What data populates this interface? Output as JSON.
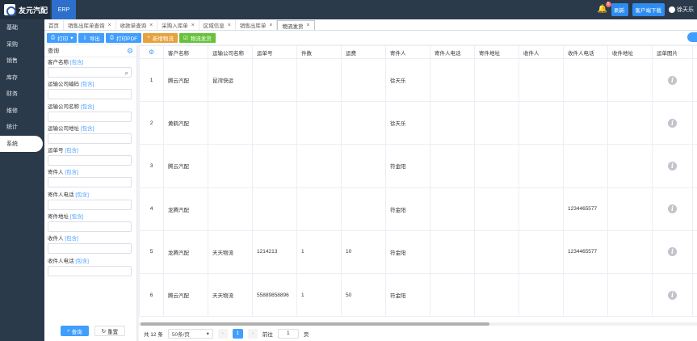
{
  "app": {
    "logo_text": "友元汽配",
    "module": "ERP"
  },
  "topbar": {
    "notification_count": "5",
    "refresh": "刷新",
    "client_download": "客户端下载",
    "user_name": "徐天乐"
  },
  "leftnav": [
    "基础",
    "采购",
    "销售",
    "库存",
    "财务",
    "维修",
    "统计",
    "系统"
  ],
  "tabs": [
    {
      "label": "首页",
      "closable": false
    },
    {
      "label": "销售出库单查询",
      "closable": true
    },
    {
      "label": "收款单查询",
      "closable": true
    },
    {
      "label": "采购入库单",
      "closable": true
    },
    {
      "label": "区域信息",
      "closable": true
    },
    {
      "label": "销售出库单",
      "closable": true
    },
    {
      "label": "物流发货",
      "closable": true,
      "active": true
    }
  ],
  "toolbar": {
    "print": "打印",
    "export": "导出",
    "print_pdf": "打印PDF",
    "add_logistics": "新增物流",
    "ship": "物流发货"
  },
  "search": {
    "title": "查询",
    "include": "[包含]",
    "fields": [
      "客户名称",
      "运输公司编码",
      "运输公司名称",
      "运输公司地址",
      "运单号",
      "寄件人",
      "寄件人电话",
      "寄件地址",
      "收件人",
      "收件人电话"
    ],
    "query_btn": "查询",
    "reset_btn": "重置"
  },
  "table": {
    "columns": [
      "客户名称",
      "运输公司名称",
      "运单号",
      "件数",
      "运费",
      "寄件人",
      "寄件人电话",
      "寄件地址",
      "收件人",
      "收件人电话",
      "收件地址",
      "运单图片"
    ],
    "rows": [
      {
        "no": "1",
        "customer": "腾云汽配",
        "carrier": "昆湾快运",
        "waybill": "",
        "pieces": "",
        "fee": "",
        "sender": "徐天乐",
        "sender_phone": "",
        "sender_addr": "",
        "receiver": "",
        "receiver_phone": "",
        "receiver_addr": ""
      },
      {
        "no": "2",
        "customer": "黄鹤汽配",
        "carrier": "",
        "waybill": "",
        "pieces": "",
        "fee": "",
        "sender": "徐天乐",
        "sender_phone": "",
        "sender_addr": "",
        "receiver": "",
        "receiver_phone": "",
        "receiver_addr": ""
      },
      {
        "no": "3",
        "customer": "腾云汽配",
        "carrier": "",
        "waybill": "",
        "pieces": "",
        "fee": "",
        "sender": "符金阳",
        "sender_phone": "",
        "sender_addr": "",
        "receiver": "",
        "receiver_phone": "",
        "receiver_addr": ""
      },
      {
        "no": "4",
        "customer": "龙腾汽配",
        "carrier": "",
        "waybill": "",
        "pieces": "",
        "fee": "",
        "sender": "符金阳",
        "sender_phone": "",
        "sender_addr": "",
        "receiver": "",
        "receiver_phone": "1234465577",
        "receiver_addr": ""
      },
      {
        "no": "5",
        "customer": "龙腾汽配",
        "carrier": "天天物流",
        "waybill": "1214213",
        "pieces": "1",
        "fee": "10",
        "sender": "符金阳",
        "sender_phone": "",
        "sender_addr": "",
        "receiver": "",
        "receiver_phone": "1234465577",
        "receiver_addr": ""
      },
      {
        "no": "6",
        "customer": "腾云汽配",
        "carrier": "天天物流",
        "waybill": "55889858896",
        "pieces": "1",
        "fee": "50",
        "sender": "符金阳",
        "sender_phone": "",
        "sender_addr": "",
        "receiver": "",
        "receiver_phone": "",
        "receiver_addr": ""
      }
    ]
  },
  "pager": {
    "total": "共 12 条",
    "page_size": "50条/页",
    "current": "1",
    "goto_label": "前往",
    "goto_value": "1",
    "page_unit": "页"
  }
}
